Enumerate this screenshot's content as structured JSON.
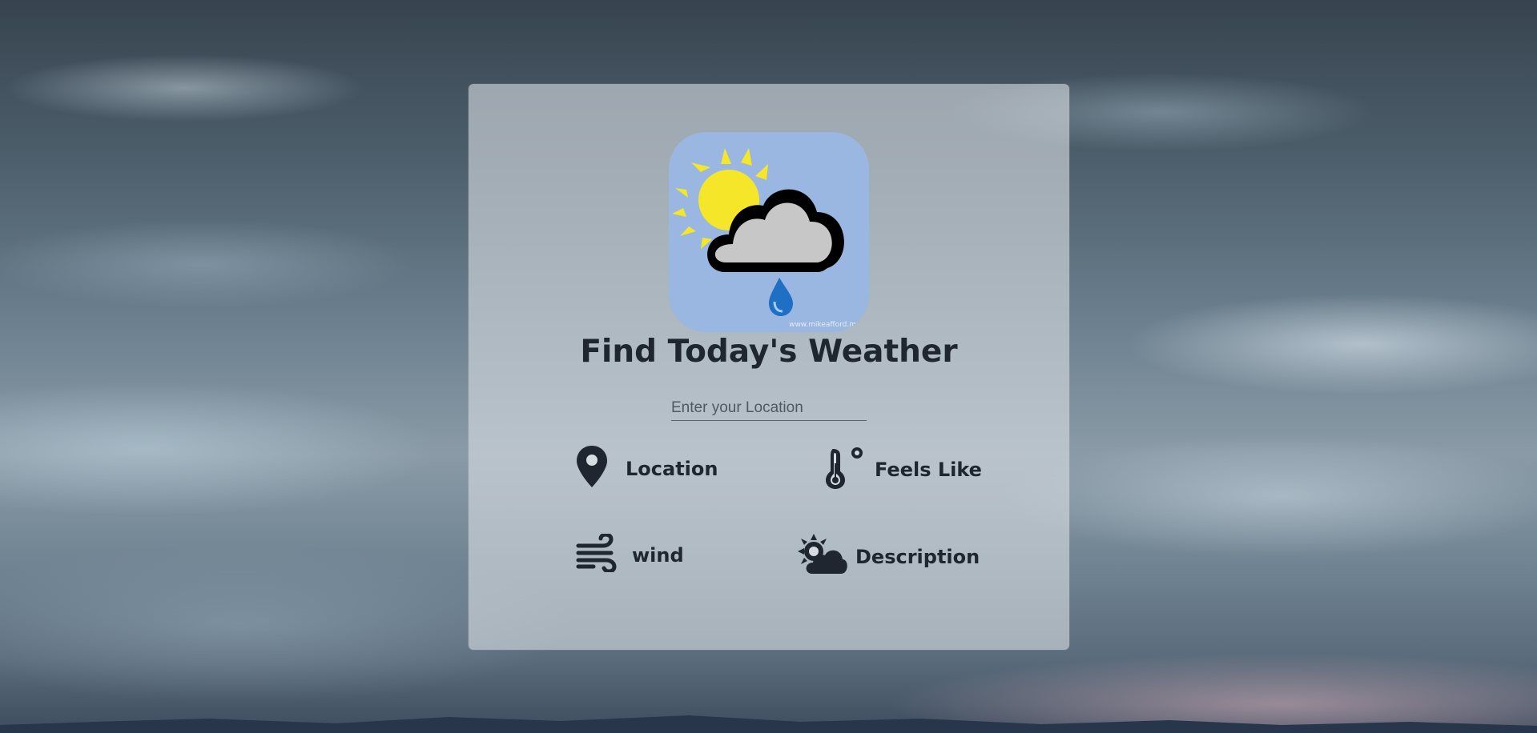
{
  "app": {
    "title": "Find Today's Weather",
    "logo_watermark": "www.mikeafford.m"
  },
  "search": {
    "placeholder": "Enter your Location",
    "value": ""
  },
  "details": {
    "location_label": "Location",
    "feels_like_label": "Feels Like",
    "wind_label": "wind",
    "description_label": "Description"
  },
  "icons": {
    "logo": "weather-sun-cloud-rain-icon",
    "location": "map-pin-icon",
    "feels_like": "thermometer-icon",
    "wind": "wind-icon",
    "description": "sun-cloud-icon"
  },
  "colors": {
    "card_bg": "#d6dce0",
    "text": "#1f2630",
    "logo_bg": "#99b7e0",
    "sun": "#f5e62a",
    "drop": "#1f6fc4"
  }
}
